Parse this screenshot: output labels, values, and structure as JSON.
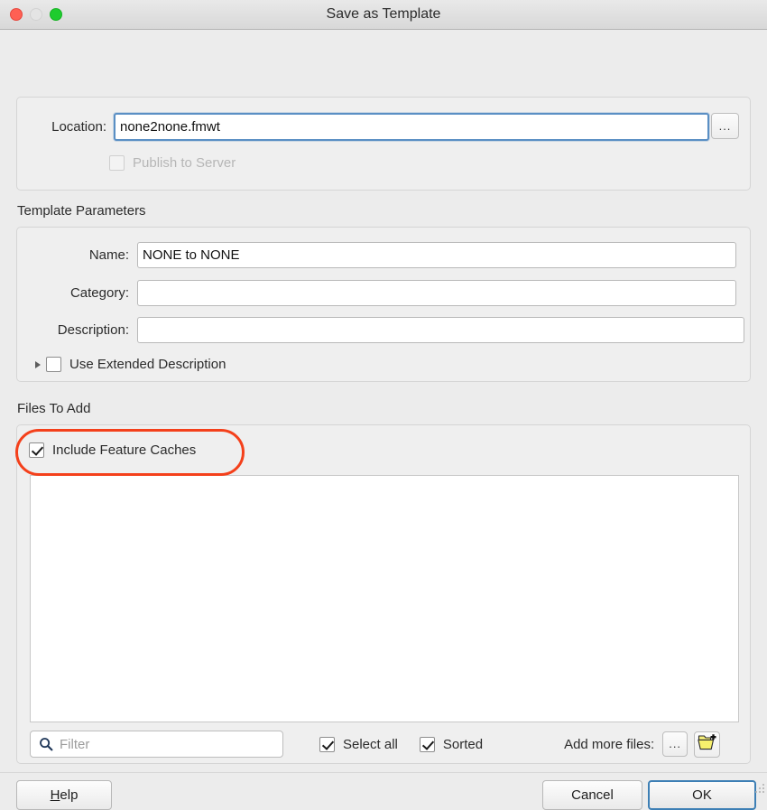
{
  "window": {
    "title": "Save as Template",
    "traffic_lights": [
      "close-button",
      "minimize-button",
      "maximize-button"
    ]
  },
  "location_group": {
    "label_text": "Location:",
    "value": "none2none.fmwt",
    "browse_button_label": "...",
    "publish_checkbox": {
      "label": "Publish to Server",
      "checked": false,
      "disabled": true
    }
  },
  "template_parameters": {
    "group_title": "Template Parameters",
    "fields": [
      {
        "label": "Name:",
        "value": "NONE to NONE",
        "placeholder": ""
      },
      {
        "label": "Category:",
        "value": "",
        "placeholder": ""
      },
      {
        "label": "Description:",
        "value": "",
        "placeholder": ""
      }
    ],
    "extended_description": {
      "label": "Use Extended Description",
      "checked": false,
      "disclosure": "collapsed"
    }
  },
  "files_to_add": {
    "group_title": "Files To Add",
    "include_feature_caches": {
      "label": "Include Feature Caches",
      "checked": true,
      "highlighted": true,
      "highlight_color": "#f4401b"
    },
    "list_items": [],
    "toolbar": {
      "filter_placeholder": "Filter",
      "filter_value": "",
      "select_all": {
        "label": "Select all",
        "checked": true
      },
      "sorted": {
        "label": "Sorted",
        "checked": true
      },
      "add_more_files_label": "Add more files:",
      "browse_button_label": "...",
      "add_folder_button": "add-folder-icon"
    }
  },
  "footer": {
    "help_label": "Help",
    "help_mnemonic": "H",
    "help_rest": "elp",
    "cancel_label": "Cancel",
    "ok_label": "OK",
    "default_button": "OK",
    "focus_color": "#3d7fb5"
  }
}
